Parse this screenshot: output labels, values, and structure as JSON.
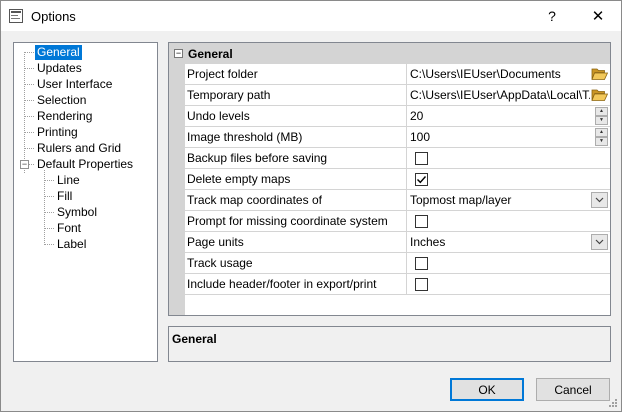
{
  "window": {
    "title": "Options",
    "help_label": "?",
    "close_label": "✕"
  },
  "tree": {
    "items": [
      {
        "label": "General",
        "selected": true
      },
      {
        "label": "Updates"
      },
      {
        "label": "User Interface"
      },
      {
        "label": "Selection"
      },
      {
        "label": "Rendering"
      },
      {
        "label": "Printing"
      },
      {
        "label": "Rulers and Grid"
      },
      {
        "label": "Default Properties",
        "expanded": true
      },
      {
        "label": "Line",
        "child": true
      },
      {
        "label": "Fill",
        "child": true
      },
      {
        "label": "Symbol",
        "child": true
      },
      {
        "label": "Font",
        "child": true
      },
      {
        "label": "Label",
        "child": true
      }
    ],
    "collapse_symbol": "−"
  },
  "grid": {
    "category": "General",
    "toggle_symbol": "−",
    "rows": [
      {
        "name": "Project folder",
        "type": "path",
        "value": "C:\\Users\\IEUser\\Documents"
      },
      {
        "name": "Temporary path",
        "type": "path",
        "value": "C:\\Users\\IEUser\\AppData\\Local\\T..."
      },
      {
        "name": "Undo levels",
        "type": "spin",
        "value": "20"
      },
      {
        "name": "Image threshold (MB)",
        "type": "spin",
        "value": "100"
      },
      {
        "name": "Backup files before saving",
        "type": "check",
        "checked": false
      },
      {
        "name": "Delete empty maps",
        "type": "check",
        "checked": true
      },
      {
        "name": "Track map coordinates of",
        "type": "dropdown",
        "value": "Topmost map/layer"
      },
      {
        "name": "Prompt for missing coordinate system",
        "type": "check",
        "checked": false
      },
      {
        "name": "Page units",
        "type": "dropdown",
        "value": "Inches"
      },
      {
        "name": "Track usage",
        "type": "check",
        "checked": false
      },
      {
        "name": "Include header/footer in export/print",
        "type": "check",
        "checked": false
      }
    ]
  },
  "description": {
    "title": "General"
  },
  "buttons": {
    "ok": "OK",
    "cancel": "Cancel"
  },
  "colors": {
    "selection": "#0078d7",
    "category_band": "#d4d4d4",
    "folder": "#e8b84a"
  },
  "icons": {
    "folder": "folder-open-icon",
    "spin_up": "▲",
    "spin_down": "▼"
  }
}
